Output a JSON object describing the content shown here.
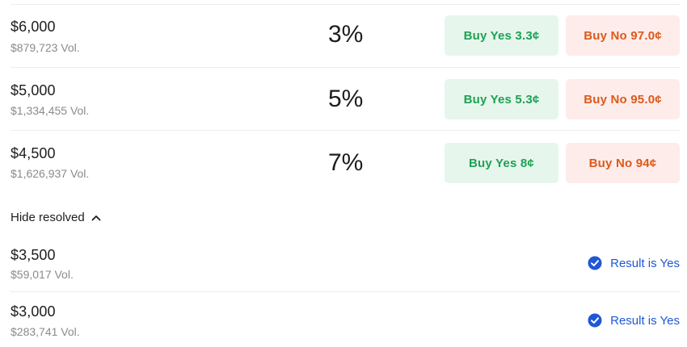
{
  "markets": [
    {
      "label": "$6,000",
      "volume": "$879,723 Vol.",
      "percent": "3%",
      "buy_yes": "Buy Yes 3.3¢",
      "buy_no": "Buy No 97.0¢"
    },
    {
      "label": "$5,000",
      "volume": "$1,334,455 Vol.",
      "percent": "5%",
      "buy_yes": "Buy Yes 5.3¢",
      "buy_no": "Buy No 95.0¢"
    },
    {
      "label": "$4,500",
      "volume": "$1,626,937 Vol.",
      "percent": "7%",
      "buy_yes": "Buy Yes 8¢",
      "buy_no": "Buy No 94¢"
    }
  ],
  "toggle": {
    "label": "Hide resolved",
    "icon": "chevron-up-icon"
  },
  "resolved": [
    {
      "label": "$3,500",
      "volume": "$59,017 Vol.",
      "result": "Result is Yes",
      "icon": "check-circle-icon"
    },
    {
      "label": "$3,000",
      "volume": "$283,741 Vol.",
      "result": "Result is Yes",
      "icon": "check-circle-icon"
    }
  ],
  "colors": {
    "yes_bg": "#e6f6ec",
    "yes_text": "#1fa155",
    "no_bg": "#fdecea",
    "no_text": "#db5a1b",
    "result_blue": "#1f57d6"
  }
}
